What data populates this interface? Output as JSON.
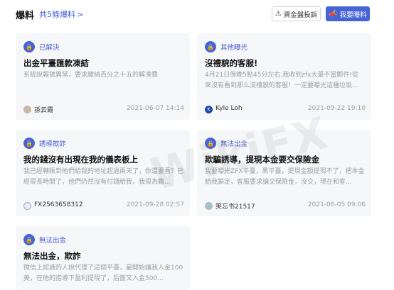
{
  "header": {
    "title": "爆料",
    "count_label": "共5條爆料",
    "complain_button": "資金盤投訴",
    "report_button": "我要曝料"
  },
  "cards": [
    {
      "tag": "已解決",
      "title": "出金平臺匯款凍結",
      "desc": "系統說報號異常，要求繳納百分之十五的解凍費",
      "user": "孫云霞",
      "date": "2021-06-07 14:14"
    },
    {
      "tag": "其他曝光",
      "title": "沒禮貌的客服!",
      "desc": "4月21日傍晚5點45分左右,我收到zfx大量不當郵件!從來沒有看到那么沒禮貌的客服！一定要曝光這種垃圾...",
      "user": "Kyle Loh",
      "date": "2021-09-22 19:10"
    },
    {
      "tag": "誘導欺詐",
      "title": "我的錢沒有出現在我的儀表板上",
      "desc": "我已經轉賬到他們給我的地址超過兩天了，你還要看？已經很長時間了，他們仍然沒有付錢給我，我很為難...",
      "user": "FX2563658312",
      "date": "2021-09-28 02:57"
    },
    {
      "tag": "無法出金",
      "title": "欺騙誘導，提現本金要交保險金",
      "desc": "我要曝光ZFX平臺，黑平臺，提現金額提現不了，把本金給我鎖定，客服要求讓交保險金，沒交，現在和客...",
      "user": "笑忘书21517",
      "date": "2021-06-05 09:06"
    },
    {
      "tag": "無法出金",
      "title": "無法出金，欺詐",
      "desc": "微信上認識的人說代理了這個平臺，最開始讓我入金100美，在他的指導下盈利提現了，后面又入金500..."
    }
  ],
  "watermark": "WikiFX"
}
